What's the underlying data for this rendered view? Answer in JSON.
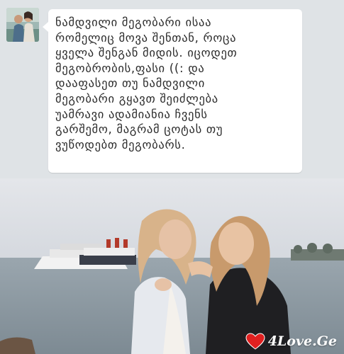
{
  "message": {
    "text": "ნამდვილი მეგობარი ისაა\nრომელიც მოვა შენთან, როცა\nყველა შენგან მიდის. იცოდეთ\nმეგობრობის,ფასი ((: და\nდააფასეთ თუ ნამდვილი\nმეგობარი გყავთ შეიძლება\nუამრავი ადამიანია ჩვენს\nგარშემო, მაგრამ ცოტას თუ\nვუწოდებთ მეგობარს."
  },
  "watermark": {
    "text": "4Love.Ge",
    "heart_color": "#e02020"
  },
  "colors": {
    "chat_background": "#dfe3e6",
    "bubble": "#ffffff",
    "text": "#2b2b2b"
  }
}
